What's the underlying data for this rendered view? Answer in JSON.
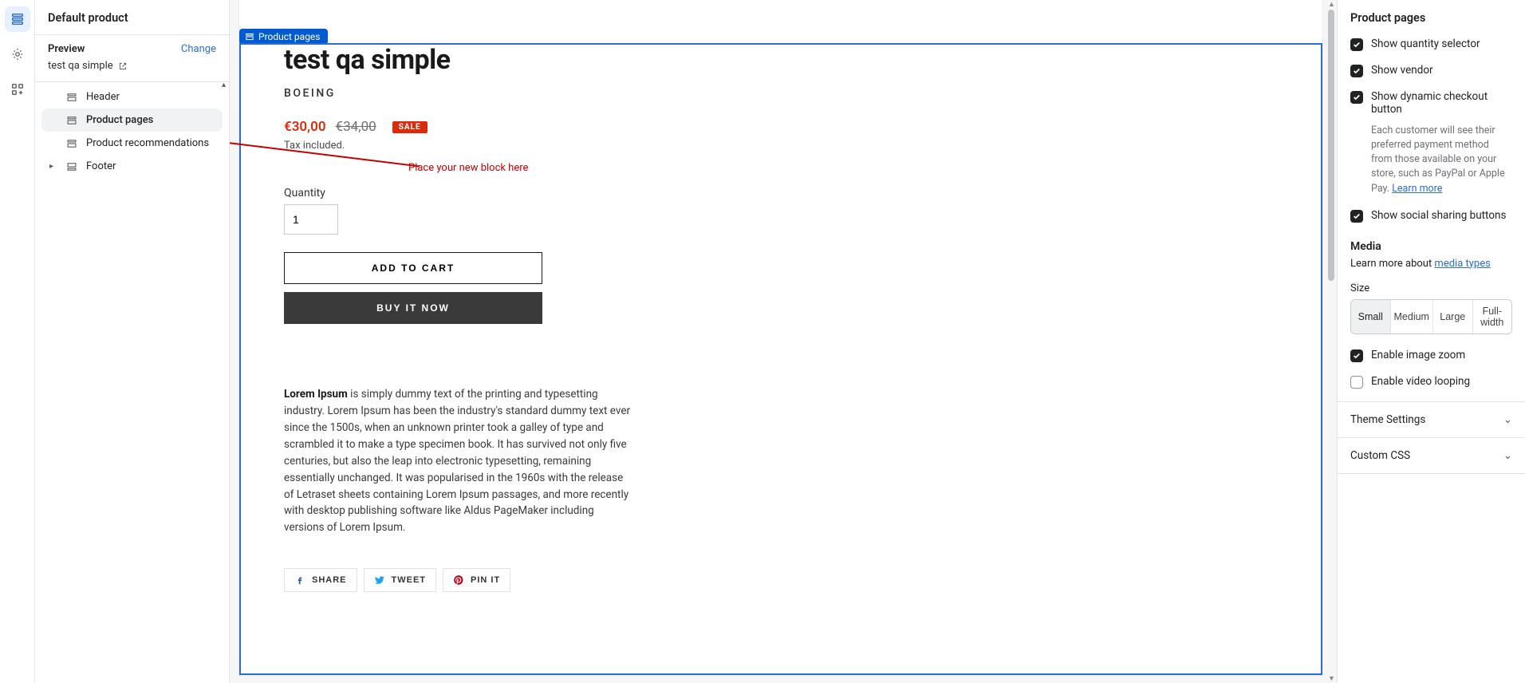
{
  "leftRail": {
    "sectionsActive": true
  },
  "tree": {
    "title": "Default product",
    "previewLabel": "Preview",
    "changeLabel": "Change",
    "previewProduct": "test qa simple",
    "items": {
      "header": "Header",
      "productPages": "Product pages",
      "productRecs": "Product recommendations",
      "footer": "Footer"
    }
  },
  "selectionTag": "Product pages",
  "product": {
    "title": "test qa simple",
    "vendor": "BOEING",
    "priceSale": "€30,00",
    "priceCompare": "€34,00",
    "saleBadge": "SALE",
    "taxNote": "Tax included.",
    "qtyLabel": "Quantity",
    "qtyValue": "1",
    "addToCart": "ADD TO CART",
    "buyNow": "BUY IT NOW",
    "descLead": "Lorem Ipsum",
    "descBody": " is simply dummy text of the printing and typesetting industry. Lorem Ipsum has been the industry's standard dummy text ever since the 1500s, when an unknown printer took a galley of type and scrambled it to make a type specimen book. It has survived not only five centuries, but also the leap into electronic typesetting, remaining essentially unchanged. It was popularised in the 1960s with the release of Letraset sheets containing Lorem Ipsum passages, and more recently with desktop publishing software like Aldus PageMaker including versions of Lorem Ipsum.",
    "share": {
      "facebook": "SHARE",
      "twitter": "TWEET",
      "pinterest": "PIN IT"
    }
  },
  "annotation": "Place your new block here",
  "settings": {
    "panelTitle": "Product pages",
    "showQty": "Show quantity selector",
    "showVendor": "Show vendor",
    "showDynamic": "Show dynamic checkout button",
    "dynamicHelp": "Each customer will see their preferred payment method from those available on your store, such as PayPal or Apple Pay. ",
    "learnMore": "Learn more",
    "showSocial": "Show social sharing buttons",
    "mediaHead": "Media",
    "mediaHelpPrefix": "Learn more about ",
    "mediaHelpLink": "media types",
    "sizeLabel": "Size",
    "sizes": {
      "small": "Small",
      "medium": "Medium",
      "large": "Large",
      "full": "Full-width"
    },
    "enableZoom": "Enable image zoom",
    "enableLoop": "Enable video looping",
    "themeSettings": "Theme Settings",
    "customCss": "Custom CSS"
  }
}
